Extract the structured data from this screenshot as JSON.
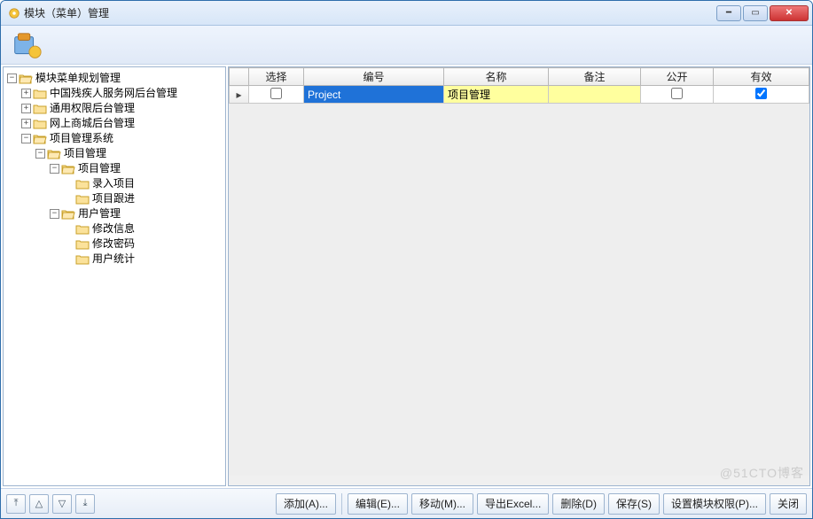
{
  "window": {
    "title": "模块（菜单）管理"
  },
  "tree": {
    "root": "模块菜单规划管理",
    "n1": "中国残疾人服务网后台管理",
    "n2": "通用权限后台管理",
    "n3": "网上商城后台管理",
    "n4": "项目管理系统",
    "n4_1": "项目管理",
    "n4_1_1": "项目管理",
    "n4_1_1_1": "录入项目",
    "n4_1_1_2": "项目跟进",
    "n4_1_2": "用户管理",
    "n4_1_2_1": "修改信息",
    "n4_1_2_2": "修改密码",
    "n4_1_2_3": "用户统计"
  },
  "grid": {
    "headers": {
      "select": "选择",
      "code": "编号",
      "name": "名称",
      "note": "备注",
      "public": "公开",
      "effective": "有效"
    },
    "row1": {
      "select": false,
      "code": "Project",
      "name": "项目管理",
      "note": "",
      "public": false,
      "effective": true
    }
  },
  "buttons": {
    "add": "添加(A)...",
    "edit": "编辑(E)...",
    "move": "移动(M)...",
    "export": "导出Excel...",
    "delete": "删除(D)",
    "save": "保存(S)",
    "perm": "设置模块权限(P)...",
    "close": "关闭"
  },
  "watermark": "@51CTO博客"
}
